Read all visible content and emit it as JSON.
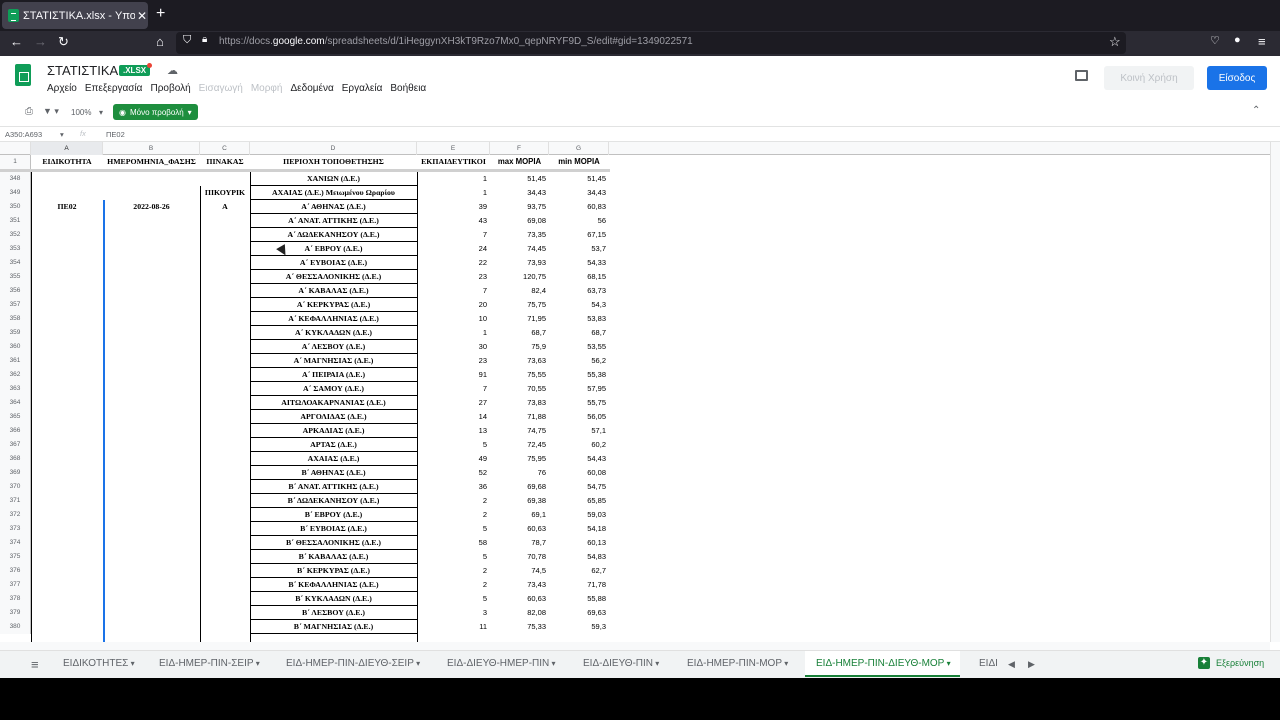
{
  "browser": {
    "tab_title": "ΣΤΑΤΙΣΤΙΚΑ.xlsx - Υπολογισ",
    "tab_close": "✕",
    "new_tab": "+",
    "url_prefix": "https://docs.",
    "url_domain": "google.com",
    "url_rest": "/spreadsheets/d/1iHeggynXH3kT9Rzo7Mx0_qepNRYF9D_S/edit#gid=1349022571",
    "icons": [
      "back-icon",
      "forward-icon",
      "reload-icon",
      "home-icon",
      "shield-icon",
      "lock-icon",
      "bookmark-star-icon",
      "pocket-icon",
      "account-icon",
      "menu-icon"
    ]
  },
  "sheets_header": {
    "doc_title": "ΣΤΑΤΙΣΤΙΚΑ",
    "badge": ".XLSX",
    "menu": [
      {
        "label": "Αρχείο",
        "enabled": true
      },
      {
        "label": "Επεξεργασία",
        "enabled": true
      },
      {
        "label": "Προβολή",
        "enabled": true
      },
      {
        "label": "Εισαγωγή",
        "enabled": false
      },
      {
        "label": "Μορφή",
        "enabled": false
      },
      {
        "label": "Δεδομένα",
        "enabled": true
      },
      {
        "label": "Εργαλεία",
        "enabled": true
      },
      {
        "label": "Βοήθεια",
        "enabled": true
      }
    ],
    "share_label": "Κοινή Χρήση",
    "signin_label": "Είσοδος"
  },
  "toolbar": {
    "zoom": "100%",
    "view_only_label": "Μόνο προβολή"
  },
  "formula_bar": {
    "name_box": "A350:A693",
    "fx": "fx",
    "value": "ΠΕ02"
  },
  "grid": {
    "column_letters": [
      "A",
      "B",
      "C",
      "D",
      "E",
      "F",
      "G"
    ],
    "header_row_number": "1",
    "headers": [
      "ΕΙΔΙΚΟΤΗΤΑ",
      "ΗΜΕΡΟΜΗΝΙΑ_ΦΑΣΗΣ",
      "ΠΙΝΑΚΑΣ",
      "ΠΕΡΙΟΧΗ ΤΟΠΟΘΕΤΗΣΗΣ",
      "ΕΚΠΑΙΔΕΥΤΙΚΟΙ",
      "max ΜΟΡΙΑ",
      "min ΜΟΡΙΑ"
    ],
    "rows": [
      {
        "n": "348",
        "a": "",
        "b": "",
        "c": "",
        "d": "ΧΑΝΙΩΝ (Δ.Ε.)",
        "e": "1",
        "f": "51,45",
        "g": "51,45"
      },
      {
        "n": "349",
        "a": "",
        "b": "",
        "c": "ΠΙΚΟΥΡΙΚ",
        "d": "ΑΧΑΙΑΣ (Δ.Ε.)  Μειωμένου Ωραρίου",
        "e": "1",
        "f": "34,43",
        "g": "34,43"
      },
      {
        "n": "350",
        "a": "ΠΕ02",
        "b": "2022-08-26",
        "c": "Α",
        "d": "Α΄ ΑΘΗΝΑΣ (Δ.Ε.)",
        "e": "39",
        "f": "93,75",
        "g": "60,83"
      },
      {
        "n": "351",
        "a": "",
        "b": "",
        "c": "",
        "d": "Α΄ ΑΝΑΤ. ΑΤΤΙΚΗΣ (Δ.Ε.)",
        "e": "43",
        "f": "69,08",
        "g": "56"
      },
      {
        "n": "352",
        "a": "",
        "b": "",
        "c": "",
        "d": "Α΄ ΔΩΔΕΚΑΝΗΣΟΥ (Δ.Ε.)",
        "e": "7",
        "f": "73,35",
        "g": "67,15"
      },
      {
        "n": "353",
        "a": "",
        "b": "",
        "c": "",
        "d": "Α΄ ΕΒΡΟΥ (Δ.Ε.)",
        "e": "24",
        "f": "74,45",
        "g": "53,7"
      },
      {
        "n": "354",
        "a": "",
        "b": "",
        "c": "",
        "d": "Α΄ ΕΥΒΟΙΑΣ (Δ.Ε.)",
        "e": "22",
        "f": "73,93",
        "g": "54,33"
      },
      {
        "n": "355",
        "a": "",
        "b": "",
        "c": "",
        "d": "Α΄ ΘΕΣΣΑΛΟΝΙΚΗΣ (Δ.Ε.)",
        "e": "23",
        "f": "120,75",
        "g": "68,15"
      },
      {
        "n": "356",
        "a": "",
        "b": "",
        "c": "",
        "d": "Α΄ ΚΑΒΑΛΑΣ (Δ.Ε.)",
        "e": "7",
        "f": "82,4",
        "g": "63,73"
      },
      {
        "n": "357",
        "a": "",
        "b": "",
        "c": "",
        "d": "Α΄ ΚΕΡΚΥΡΑΣ (Δ.Ε.)",
        "e": "20",
        "f": "75,75",
        "g": "54,3"
      },
      {
        "n": "358",
        "a": "",
        "b": "",
        "c": "",
        "d": "Α΄ ΚΕΦΑΛΛΗΝΙΑΣ (Δ.Ε.)",
        "e": "10",
        "f": "71,95",
        "g": "53,83"
      },
      {
        "n": "359",
        "a": "",
        "b": "",
        "c": "",
        "d": "Α΄ ΚΥΚΛΑΔΩΝ (Δ.Ε.)",
        "e": "1",
        "f": "68,7",
        "g": "68,7"
      },
      {
        "n": "360",
        "a": "",
        "b": "",
        "c": "",
        "d": "Α΄ ΛΕΣΒΟΥ (Δ.Ε.)",
        "e": "30",
        "f": "75,9",
        "g": "53,55"
      },
      {
        "n": "361",
        "a": "",
        "b": "",
        "c": "",
        "d": "Α΄ ΜΑΓΝΗΣΙΑΣ (Δ.Ε.)",
        "e": "23",
        "f": "73,63",
        "g": "56,2"
      },
      {
        "n": "362",
        "a": "",
        "b": "",
        "c": "",
        "d": "Α΄ ΠΕΙΡΑΙΑ (Δ.Ε.)",
        "e": "91",
        "f": "75,55",
        "g": "55,38"
      },
      {
        "n": "363",
        "a": "",
        "b": "",
        "c": "",
        "d": "Α΄ ΣΑΜΟΥ (Δ.Ε.)",
        "e": "7",
        "f": "70,55",
        "g": "57,95"
      },
      {
        "n": "364",
        "a": "",
        "b": "",
        "c": "",
        "d": "ΑΙΤΩΛΟΑΚΑΡΝΑΝΙΑΣ (Δ.Ε.)",
        "e": "27",
        "f": "73,83",
        "g": "55,75"
      },
      {
        "n": "365",
        "a": "",
        "b": "",
        "c": "",
        "d": "ΑΡΓΟΛΙΔΑΣ (Δ.Ε.)",
        "e": "14",
        "f": "71,88",
        "g": "56,05"
      },
      {
        "n": "366",
        "a": "",
        "b": "",
        "c": "",
        "d": "ΑΡΚΑΔΙΑΣ (Δ.Ε.)",
        "e": "13",
        "f": "74,75",
        "g": "57,1"
      },
      {
        "n": "367",
        "a": "",
        "b": "",
        "c": "",
        "d": "ΑΡΤΑΣ (Δ.Ε.)",
        "e": "5",
        "f": "72,45",
        "g": "60,2"
      },
      {
        "n": "368",
        "a": "",
        "b": "",
        "c": "",
        "d": "ΑΧΑΙΑΣ (Δ.Ε.)",
        "e": "49",
        "f": "75,95",
        "g": "54,43"
      },
      {
        "n": "369",
        "a": "",
        "b": "",
        "c": "",
        "d": "Β΄ ΑΘΗΝΑΣ (Δ.Ε.)",
        "e": "52",
        "f": "76",
        "g": "60,08"
      },
      {
        "n": "370",
        "a": "",
        "b": "",
        "c": "",
        "d": "Β΄ ΑΝΑΤ. ΑΤΤΙΚΗΣ (Δ.Ε.)",
        "e": "36",
        "f": "69,68",
        "g": "54,75"
      },
      {
        "n": "371",
        "a": "",
        "b": "",
        "c": "",
        "d": "Β΄ ΔΩΔΕΚΑΝΗΣΟΥ (Δ.Ε.)",
        "e": "2",
        "f": "69,38",
        "g": "65,85"
      },
      {
        "n": "372",
        "a": "",
        "b": "",
        "c": "",
        "d": "Β΄ ΕΒΡΟΥ (Δ.Ε.)",
        "e": "2",
        "f": "69,1",
        "g": "59,03"
      },
      {
        "n": "373",
        "a": "",
        "b": "",
        "c": "",
        "d": "Β΄ ΕΥΒΟΙΑΣ (Δ.Ε.)",
        "e": "5",
        "f": "60,63",
        "g": "54,18"
      },
      {
        "n": "374",
        "a": "",
        "b": "",
        "c": "",
        "d": "Β΄ ΘΕΣΣΑΛΟΝΙΚΗΣ (Δ.Ε.)",
        "e": "58",
        "f": "78,7",
        "g": "60,13"
      },
      {
        "n": "375",
        "a": "",
        "b": "",
        "c": "",
        "d": "Β΄ ΚΑΒΑΛΑΣ (Δ.Ε.)",
        "e": "5",
        "f": "70,78",
        "g": "54,83"
      },
      {
        "n": "376",
        "a": "",
        "b": "",
        "c": "",
        "d": "Β΄ ΚΕΡΚΥΡΑΣ (Δ.Ε.)",
        "e": "2",
        "f": "74,5",
        "g": "62,7"
      },
      {
        "n": "377",
        "a": "",
        "b": "",
        "c": "",
        "d": "Β΄ ΚΕΦΑΛΛΗΝΙΑΣ (Δ.Ε.)",
        "e": "2",
        "f": "73,43",
        "g": "71,78"
      },
      {
        "n": "378",
        "a": "",
        "b": "",
        "c": "",
        "d": "Β΄ ΚΥΚΛΑΔΩΝ (Δ.Ε.)",
        "e": "5",
        "f": "60,63",
        "g": "55,88"
      },
      {
        "n": "379",
        "a": "",
        "b": "",
        "c": "",
        "d": "Β΄ ΛΕΣΒΟΥ (Δ.Ε.)",
        "e": "3",
        "f": "82,08",
        "g": "69,63"
      },
      {
        "n": "380",
        "a": "",
        "b": "",
        "c": "",
        "d": "Β΄ ΜΑΓΝΗΣΙΑΣ (Δ.Ε.)",
        "e": "11",
        "f": "75,33",
        "g": "59,3"
      }
    ]
  },
  "sheet_tabs": [
    {
      "label": "ΕΙΔΙΚΟΤΗΤΕΣ",
      "active": false
    },
    {
      "label": "ΕΙΔ-ΗΜΕΡ-ΠΙΝ-ΣΕΙΡ",
      "active": false
    },
    {
      "label": "ΕΙΔ-ΗΜΕΡ-ΠΙΝ-ΔΙΕΥΘ-ΣΕΙΡ",
      "active": false
    },
    {
      "label": "ΕΙΔ-ΔΙΕΥΘ-ΗΜΕΡ-ΠΙΝ",
      "active": false
    },
    {
      "label": "ΕΙΔ-ΔΙΕΥΘ-ΠΙΝ",
      "active": false
    },
    {
      "label": "ΕΙΔ-ΗΜΕΡ-ΠΙΝ-ΜΟΡ",
      "active": false
    },
    {
      "label": "ΕΙΔ-ΗΜΕΡ-ΠΙΝ-ΔΙΕΥΘ-ΜΟΡ",
      "active": true
    },
    {
      "label": "ΕΙΔΙ",
      "active": false
    }
  ],
  "explore_label": "Εξερεύνηση",
  "colors": {
    "green": "#0f9d58",
    "active_tab": "#188038",
    "signin": "#1a73e8"
  }
}
